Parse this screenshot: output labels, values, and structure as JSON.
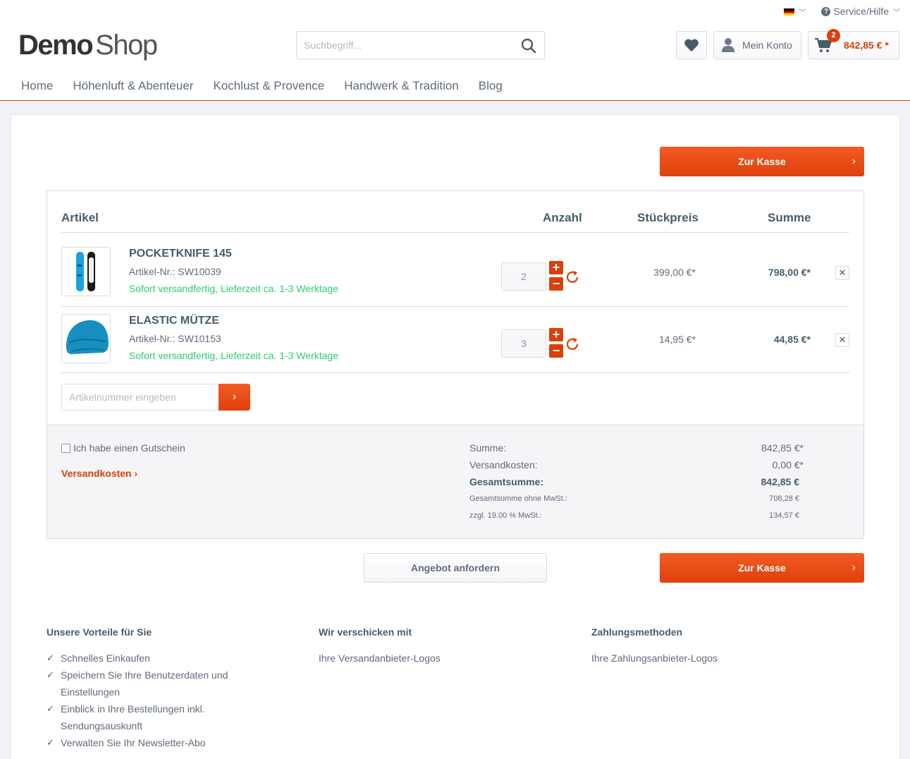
{
  "topbar": {
    "service_label": "Service/Hilfe"
  },
  "logo": {
    "part1": "Demo",
    "part2": "Shop"
  },
  "search": {
    "placeholder": "Suchbegriff..."
  },
  "account": {
    "label": "Mein Konto"
  },
  "cart": {
    "count": "2",
    "amount": "842,85 € *"
  },
  "nav": [
    "Home",
    "Höhenluft & Abenteuer",
    "Kochlust & Provence",
    "Handwerk & Tradition",
    "Blog"
  ],
  "checkout": {
    "label": "Zur Kasse",
    "arrow": "›"
  },
  "table": {
    "col_article": "Artikel",
    "col_qty": "Anzahl",
    "col_unit": "Stückpreis",
    "col_total": "Summe"
  },
  "items": [
    {
      "name": "POCKETKNIFE 145",
      "number": "Artikel-Nr.: SW10039",
      "delivery": "Sofort versandfertig, Lieferzeit ca. 1-3 Werktage",
      "qty": "2",
      "unit_price": "399,00 €*",
      "total": "798,00 €*"
    },
    {
      "name": "ELASTIC MÜTZE",
      "number": "Artikel-Nr.: SW10153",
      "delivery": "Sofort versandfertig, Lieferzeit ca. 1-3 Werktage",
      "qty": "3",
      "unit_price": "14,95 €*",
      "total": "44,85 €*"
    }
  ],
  "add_article": {
    "placeholder": "Artikelnummer eingeben",
    "button": "›"
  },
  "voucher": {
    "label": "Ich habe einen Gutschein"
  },
  "shipping": {
    "label": "Versandkosten ›"
  },
  "summary": {
    "sum_label": "Summe:",
    "sum_value": "842,85 €*",
    "shipping_label": "Versandkosten:",
    "shipping_value": "0,00 €*",
    "grand_label": "Gesamtsumme:",
    "grand_value": "842,85 €",
    "net_label": "Gesamtsumme ohne MwSt.:",
    "net_value": "708,28 €",
    "tax_label": "zzgl. 19.00 % MwSt.:",
    "tax_value": "134,57 €"
  },
  "offer": {
    "label": "Angebot anfordern"
  },
  "footer": {
    "benefits_title": "Unsere Vorteile für Sie",
    "benefits": [
      "Schnelles Einkaufen",
      "Speichern Sie Ihre Benutzerdaten und Einstellungen",
      "Einblick in Ihre Bestellungen inkl. Sendungsauskunft",
      "Verwalten Sie Ihr Newsletter-Abo"
    ],
    "shipping_title": "Wir verschicken mit",
    "shipping_text": "Ihre Versandanbieter-Logos",
    "payment_title": "Zahlungsmethoden",
    "payment_text": "Ihre Zahlungsanbieter-Logos"
  },
  "colors": {
    "accent": "#d9400b",
    "success": "#2ecc71",
    "text": "#5f6b7a",
    "heading": "#475c6a"
  },
  "icons": {
    "flag": "german-flag-icon",
    "help": "question-circle-icon",
    "search": "search-icon",
    "wishlist": "heart-icon",
    "account": "user-icon",
    "cart": "cart-icon"
  }
}
